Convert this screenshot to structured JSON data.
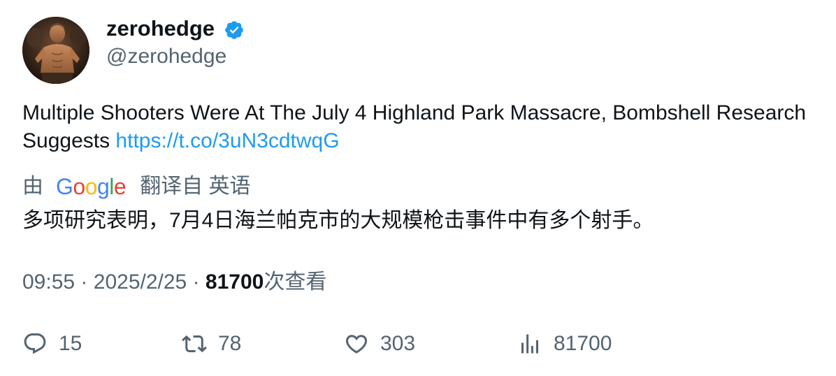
{
  "author": {
    "display_name": "zerohedge",
    "handle": "@zerohedge",
    "verified": true,
    "verified_color": "#1d9bf0"
  },
  "tweet": {
    "text": "Multiple Shooters Were At The July 4 Highland Park Massacre, Bombshell Research Suggests ",
    "link_text": "https://t.co/3uN3cdtwqG",
    "link_color": "#1d9bf0"
  },
  "translation": {
    "by_label": "由",
    "provider": "Google",
    "translated_from_label": "翻译自 英语",
    "text": "多项研究表明，7月4日海兰帕克市的大规模枪击事件中有多个射手。"
  },
  "meta": {
    "time": "09:55",
    "separator": "·",
    "date": "2025/2/25",
    "views_count": "81700",
    "views_label": "次查看"
  },
  "actions": {
    "replies": "15",
    "retweets": "78",
    "likes": "303",
    "views": "81700"
  },
  "colors": {
    "text_primary": "#0f1419",
    "text_secondary": "#536471",
    "google_blue": "#4285f4",
    "google_red": "#ea4335",
    "google_yellow": "#fbbc05",
    "google_green": "#34a853"
  }
}
